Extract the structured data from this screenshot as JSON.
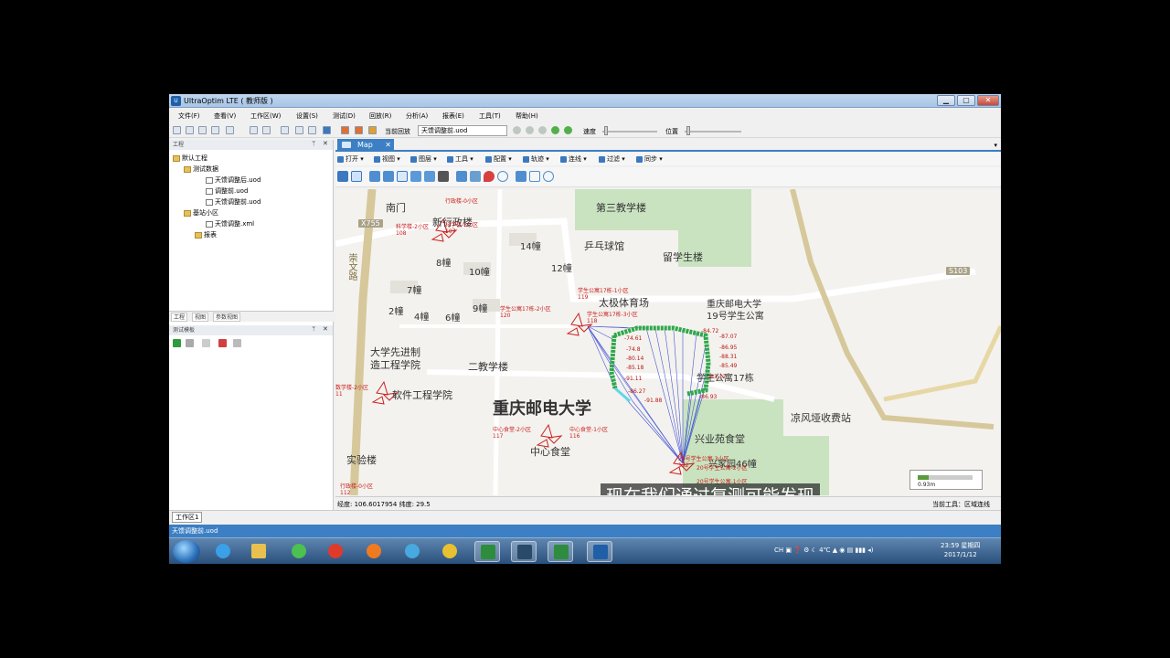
{
  "window": {
    "title": "UltraOptim  LTE ( 教师版 )",
    "app_icon": "U"
  },
  "menu": [
    "文件(F)",
    "查看(V)",
    "工作区(W)",
    "设置(S)",
    "测试(D)",
    "回放(R)",
    "分析(A)",
    "报表(E)",
    "工具(T)",
    "帮助(H)"
  ],
  "toolbar": {
    "playback_label": "当前回放",
    "playback_file": "天馈调整前.uod",
    "speed_label": "速度",
    "position_label": "位置"
  },
  "project_panel": {
    "title": "工程",
    "tree": [
      {
        "label": "默认工程",
        "type": "folder"
      },
      {
        "label": "测试数据",
        "type": "folder"
      },
      {
        "label": "天馈调整后.uod",
        "type": "file"
      },
      {
        "label": "调整前.uod",
        "type": "file"
      },
      {
        "label": "天馈调整前.uod",
        "type": "file"
      },
      {
        "label": "基站小区",
        "type": "folder"
      },
      {
        "label": "天馈调整.xml",
        "type": "file"
      },
      {
        "label": "报表",
        "type": "folder"
      }
    ],
    "tabs": [
      "工程",
      "视图",
      "参数视图"
    ]
  },
  "template_panel": {
    "title": "测试模板"
  },
  "map_tab": {
    "label": "Map",
    "close": "✕"
  },
  "map_toolbar": [
    "打开",
    "视图",
    "图层",
    "工具",
    "配置",
    "轨迹",
    "连线",
    "过滤",
    "同步"
  ],
  "map": {
    "big_label": "重庆邮电大学",
    "pois": [
      {
        "name": "第三教学楼",
        "k": "a"
      },
      {
        "name": "乒乓球馆",
        "k": "b"
      },
      {
        "name": "留学生楼",
        "k": "c"
      },
      {
        "name": "太极体育场",
        "k": "d"
      },
      {
        "name": "重庆邮电大学\n19号学生公寓",
        "k": "e"
      },
      {
        "name": "大学先进制\n造工程学院",
        "k": "f"
      },
      {
        "name": "二教学楼",
        "k": "g"
      },
      {
        "name": "软件工程学院",
        "k": "h"
      },
      {
        "name": "中心食堂",
        "k": "i"
      },
      {
        "name": "兴业苑食堂",
        "k": "j"
      },
      {
        "name": "凉风垭收费站",
        "k": "k"
      },
      {
        "name": "实验楼",
        "k": "l"
      },
      {
        "name": "新行政楼",
        "k": "m"
      },
      {
        "name": "南门",
        "k": "n"
      },
      {
        "name": "学生公寓17栋",
        "k": "o"
      },
      {
        "name": "兴家园46幢",
        "k": "p"
      }
    ],
    "buildings": [
      "14幢",
      "8幢",
      "10幢",
      "12幢",
      "7幢",
      "9幢",
      "2幢",
      "4幢",
      "6幢"
    ],
    "roads": [
      "X755",
      "S103",
      "崇文路"
    ],
    "cell_labels": [
      "学生公寓17栋-1小区\n119",
      "学生公寓17栋-2小区\n120",
      "学生公寓17栋-3小区\n118",
      "中心食堂-2小区\n117",
      "中心食堂-1小区\n116",
      "科学楼-2小区\n108",
      "科学楼-3小区\n107",
      "数学楼-2小区\n11",
      "20号学生公寓-3小区\n112",
      "20号学生公寓-2小区",
      "20号学生公寓-1小区",
      "行政楼-0小区",
      "行政楼-0小区\n112"
    ],
    "rssi": [
      "-74.61",
      "-74.8",
      "-80.14",
      "-85.18",
      "-91.11",
      "-86.27",
      "-91.88",
      "-84.72",
      "-87.07",
      "-86.95",
      "-88.31",
      "-85.49",
      "-83.12",
      "-86.93"
    ],
    "scale": "0.93m",
    "subtitle": "现在我们通过复测可能发现"
  },
  "map_status": {
    "coords": "经度: 106.6017954  纬度: 29.5",
    "current_tool": "当前工具：区域连线"
  },
  "workspace_tab": "工作区1",
  "status_bar": "天馈调整前.uod",
  "taskbar": {
    "tray": "CH  ▣  ❓  ⚙  ☾  4℃  ▲  ◉  ▤  ▮▮▮  ◂)",
    "time": "23:59 星期四",
    "date": "2017/1/12"
  },
  "colors": {
    "accent": "#3c7fc4",
    "drive_route": "#2ea84a",
    "link_lines": "#1a2fd0",
    "cell_label": "#c82020"
  }
}
